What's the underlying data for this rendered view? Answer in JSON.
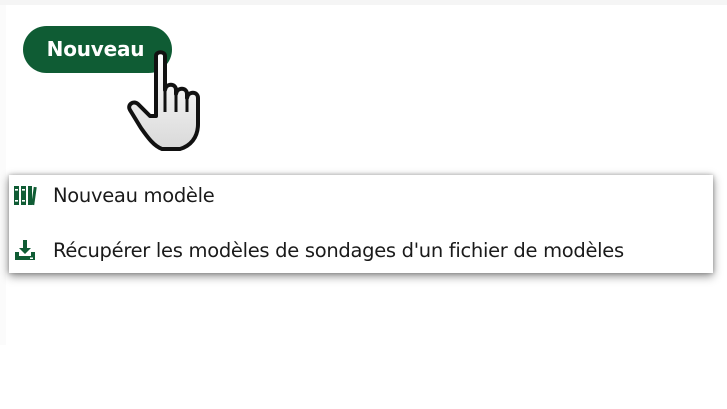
{
  "toolbar": {
    "new_button_label": "Nouveau",
    "accent_color": "#0f5c34"
  },
  "cursor": {
    "icon": "hand-pointer-icon"
  },
  "menu": {
    "items": [
      {
        "label": "Nouveau modèle",
        "icon": "books-icon"
      },
      {
        "label": "Récupérer les modèles de sondages d'un fichier de modèles",
        "icon": "download-tray-icon"
      }
    ]
  }
}
